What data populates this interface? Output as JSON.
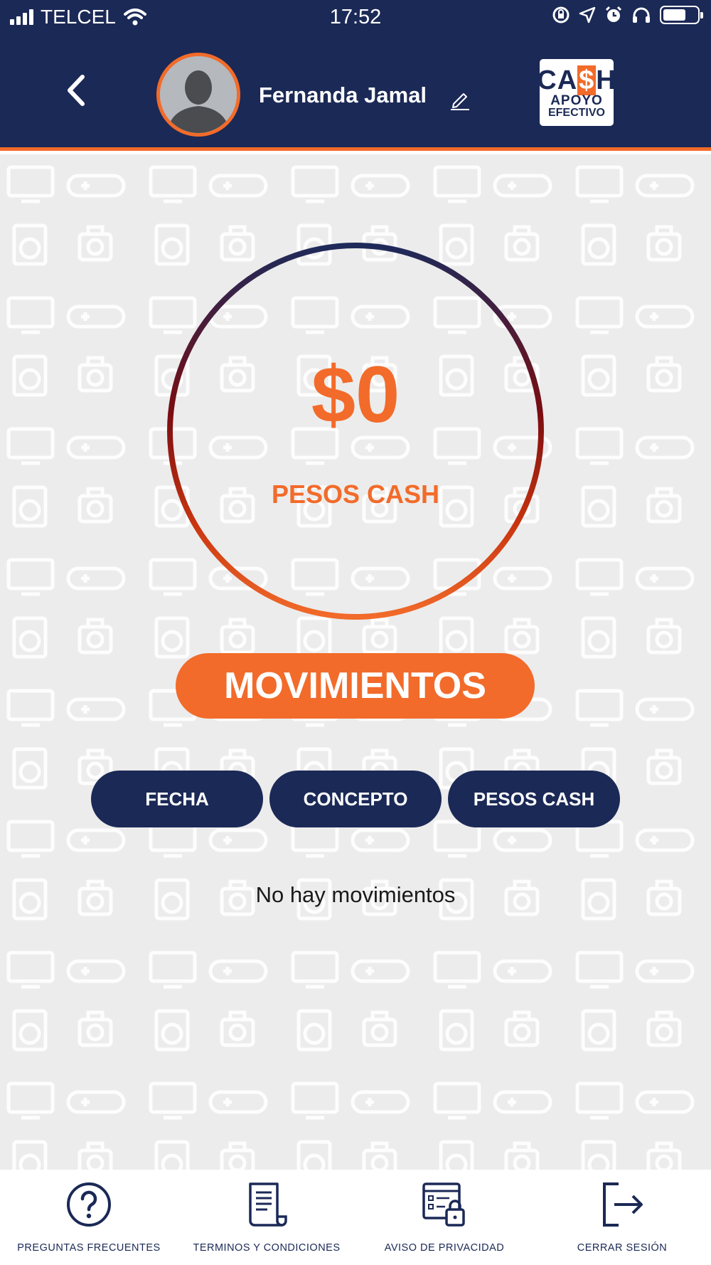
{
  "status_bar": {
    "carrier": "TELCEL",
    "time": "17:52"
  },
  "header": {
    "user_name": "Fernanda Jamal",
    "logo": {
      "brand_left": "CA",
      "brand_dollar": "$",
      "brand_right": "H",
      "line1": "APOYO",
      "line2": "EFECTIVO"
    }
  },
  "balance": {
    "amount": "$0",
    "label": "PESOS CASH"
  },
  "movements": {
    "title": "MOVIMIENTOS",
    "columns": [
      "FECHA",
      "CONCEPTO",
      "PESOS CASH"
    ],
    "empty_message": "No hay movimientos"
  },
  "bottom_nav": [
    {
      "label": "PREGUNTAS FRECUENTES",
      "icon": "question-circle-icon"
    },
    {
      "label": "TERMINOS Y CONDICIONES",
      "icon": "document-scroll-icon"
    },
    {
      "label": "AVISO DE PRIVACIDAD",
      "icon": "privacy-lock-icon"
    },
    {
      "label": "CERRAR SESIÓN",
      "icon": "logout-icon"
    }
  ],
  "colors": {
    "navy": "#1b2956",
    "orange": "#f26b2a",
    "background": "#ececec"
  }
}
